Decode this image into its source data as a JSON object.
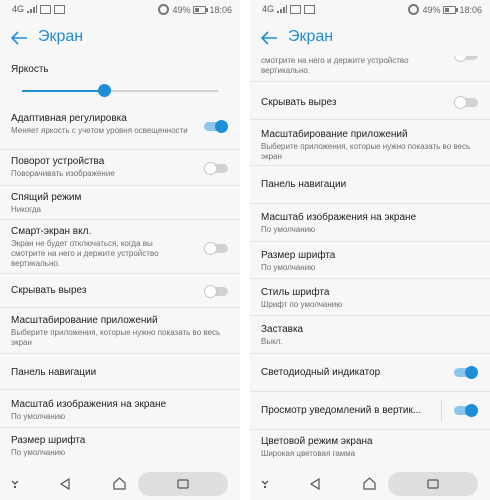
{
  "status_bar": {
    "network": "4G",
    "battery": "49%",
    "time": "18:06"
  },
  "header": {
    "title": "Экран"
  },
  "left": {
    "brightness_label": "Яркость",
    "brightness_level": 0.42,
    "items": [
      {
        "title": "Адаптивная регулировка",
        "sub": "Меняет яркость с учетом уровня освещенности",
        "toggle": true
      },
      {
        "title": "Поворот устройства",
        "sub": "Поворачивать изображение",
        "toggle": false
      },
      {
        "title": "Спящий режим",
        "sub": "Никогда"
      },
      {
        "title": "Смарт-экран вкл.",
        "sub": "Экран не будет отключаться, когда вы смотрите на него и держите устройство вертикально.",
        "toggle": false
      },
      {
        "title": "Скрывать вырез",
        "toggle": false
      },
      {
        "title": "Масштабирование приложений",
        "sub": "Выберите приложения, которые нужно показать во весь экран"
      },
      {
        "title": "Панель навигации"
      },
      {
        "title": "Масштаб изображения на экране",
        "sub": "По умолчанию"
      },
      {
        "title": "Размер шрифта",
        "sub": "По умолчанию"
      }
    ]
  },
  "right": {
    "partial_top": "смотрите на него и держите устройство вертикально.",
    "items": [
      {
        "title": "Скрывать вырез",
        "toggle": false
      },
      {
        "title": "Масштабирование приложений",
        "sub": "Выберите приложения, которые нужно показать во весь экран"
      },
      {
        "title": "Панель навигации"
      },
      {
        "title": "Масштаб изображения на экране",
        "sub": "По умолчанию"
      },
      {
        "title": "Размер шрифта",
        "sub": "По умолчанию"
      },
      {
        "title": "Стиль шрифта",
        "sub": "Шрифт по умолчанию"
      },
      {
        "title": "Заставка",
        "sub": "Выкл."
      },
      {
        "title": "Светодиодный индикатор",
        "toggle": true
      },
      {
        "title": "Просмотр уведомлений в вертик...",
        "toggle": true
      },
      {
        "title": "Цветовой режим экрана",
        "sub": "Широкая цветовая гамма"
      }
    ]
  },
  "colors": {
    "accent": "#1e8fd6",
    "accent_light": "#8cc6ec",
    "divider": "#e4e4e4"
  }
}
